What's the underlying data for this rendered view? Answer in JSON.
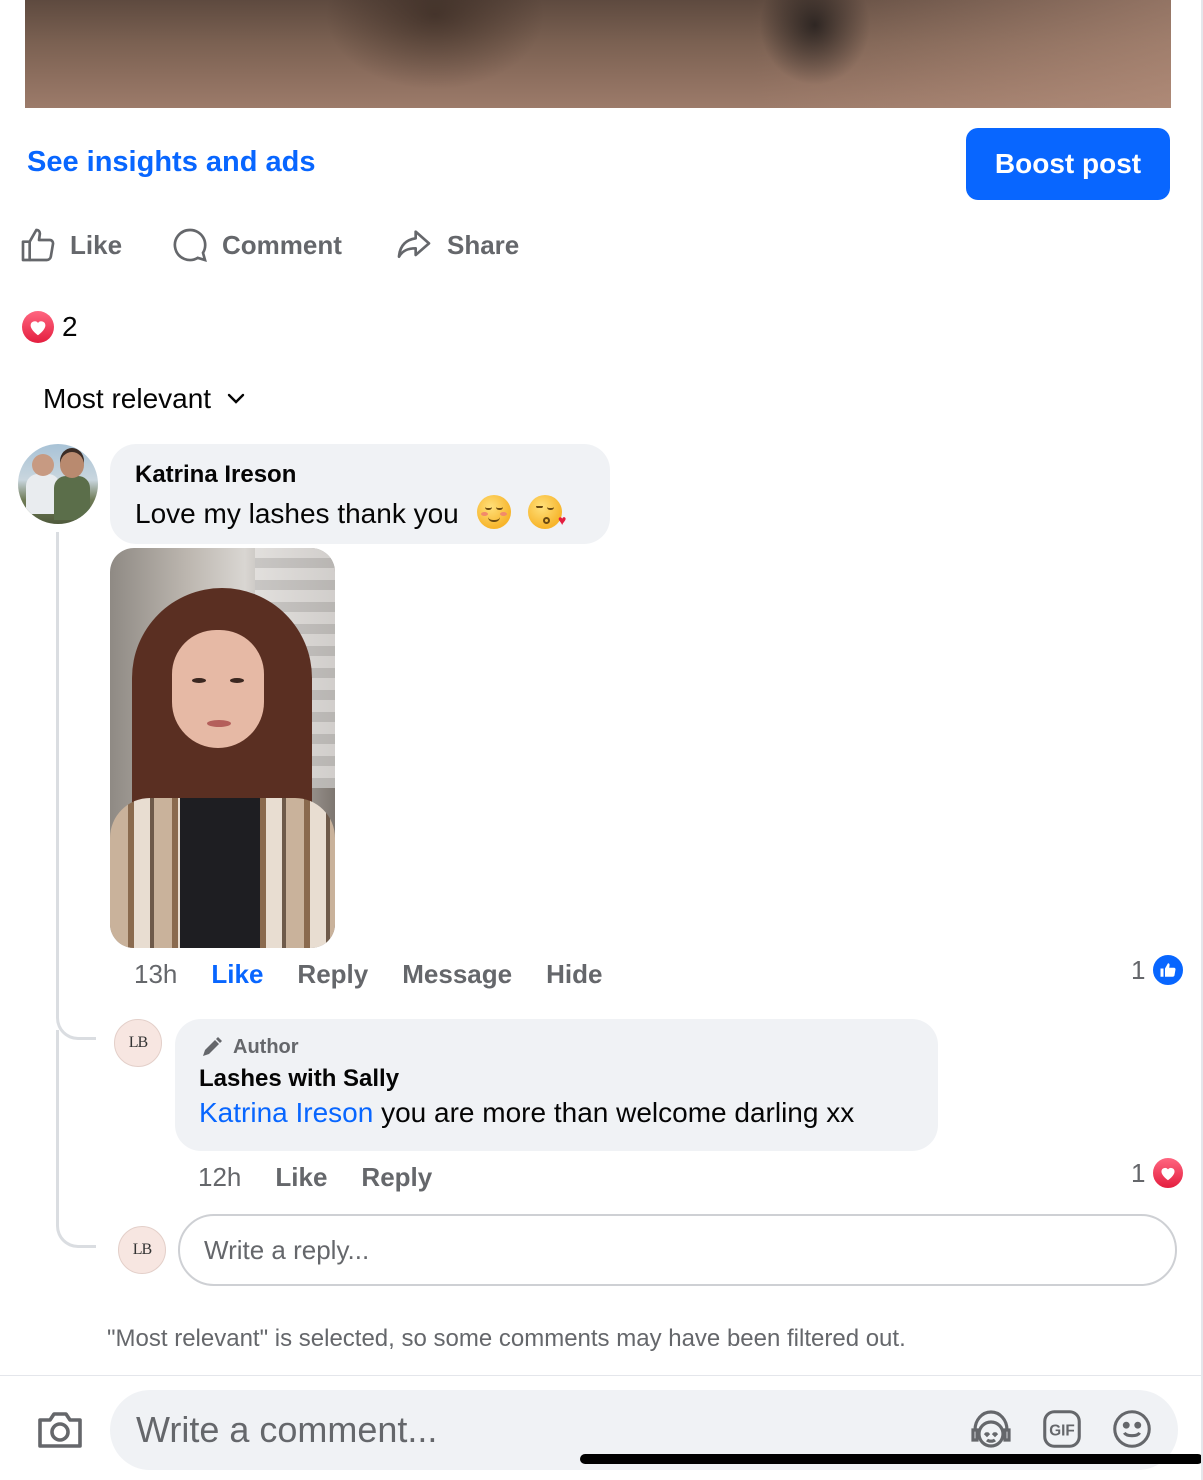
{
  "post": {
    "insights_link": "See insights and ads",
    "boost_button": "Boost post"
  },
  "actions": {
    "like": "Like",
    "comment": "Comment",
    "share": "Share"
  },
  "reactions": {
    "count": "2",
    "type": "heart"
  },
  "sort": {
    "label": "Most relevant"
  },
  "comment": {
    "author": "Katrina Ireson",
    "text": "Love my lashes thank you",
    "time": "13h",
    "like": "Like",
    "reply": "Reply",
    "message": "Message",
    "hide": "Hide",
    "reaction_count": "1",
    "reaction_type": "like"
  },
  "reply": {
    "badge": "Author",
    "author": "Lashes with Sally",
    "mention": "Katrina Ireson",
    "text": "you are more than welcome darling xx",
    "time": "12h",
    "like": "Like",
    "reply": "Reply",
    "reaction_count": "1",
    "reaction_type": "love",
    "avatar_text": "LB"
  },
  "reply_input": {
    "placeholder": "Write a reply..."
  },
  "filter_note": "\"Most relevant\" is selected, so some comments may have been filtered out.",
  "composer": {
    "placeholder": "Write a comment..."
  },
  "colors": {
    "accent": "#0866ff",
    "love": "#e41e3f",
    "secondary_text": "#65676b",
    "bubble": "#f0f2f5"
  }
}
